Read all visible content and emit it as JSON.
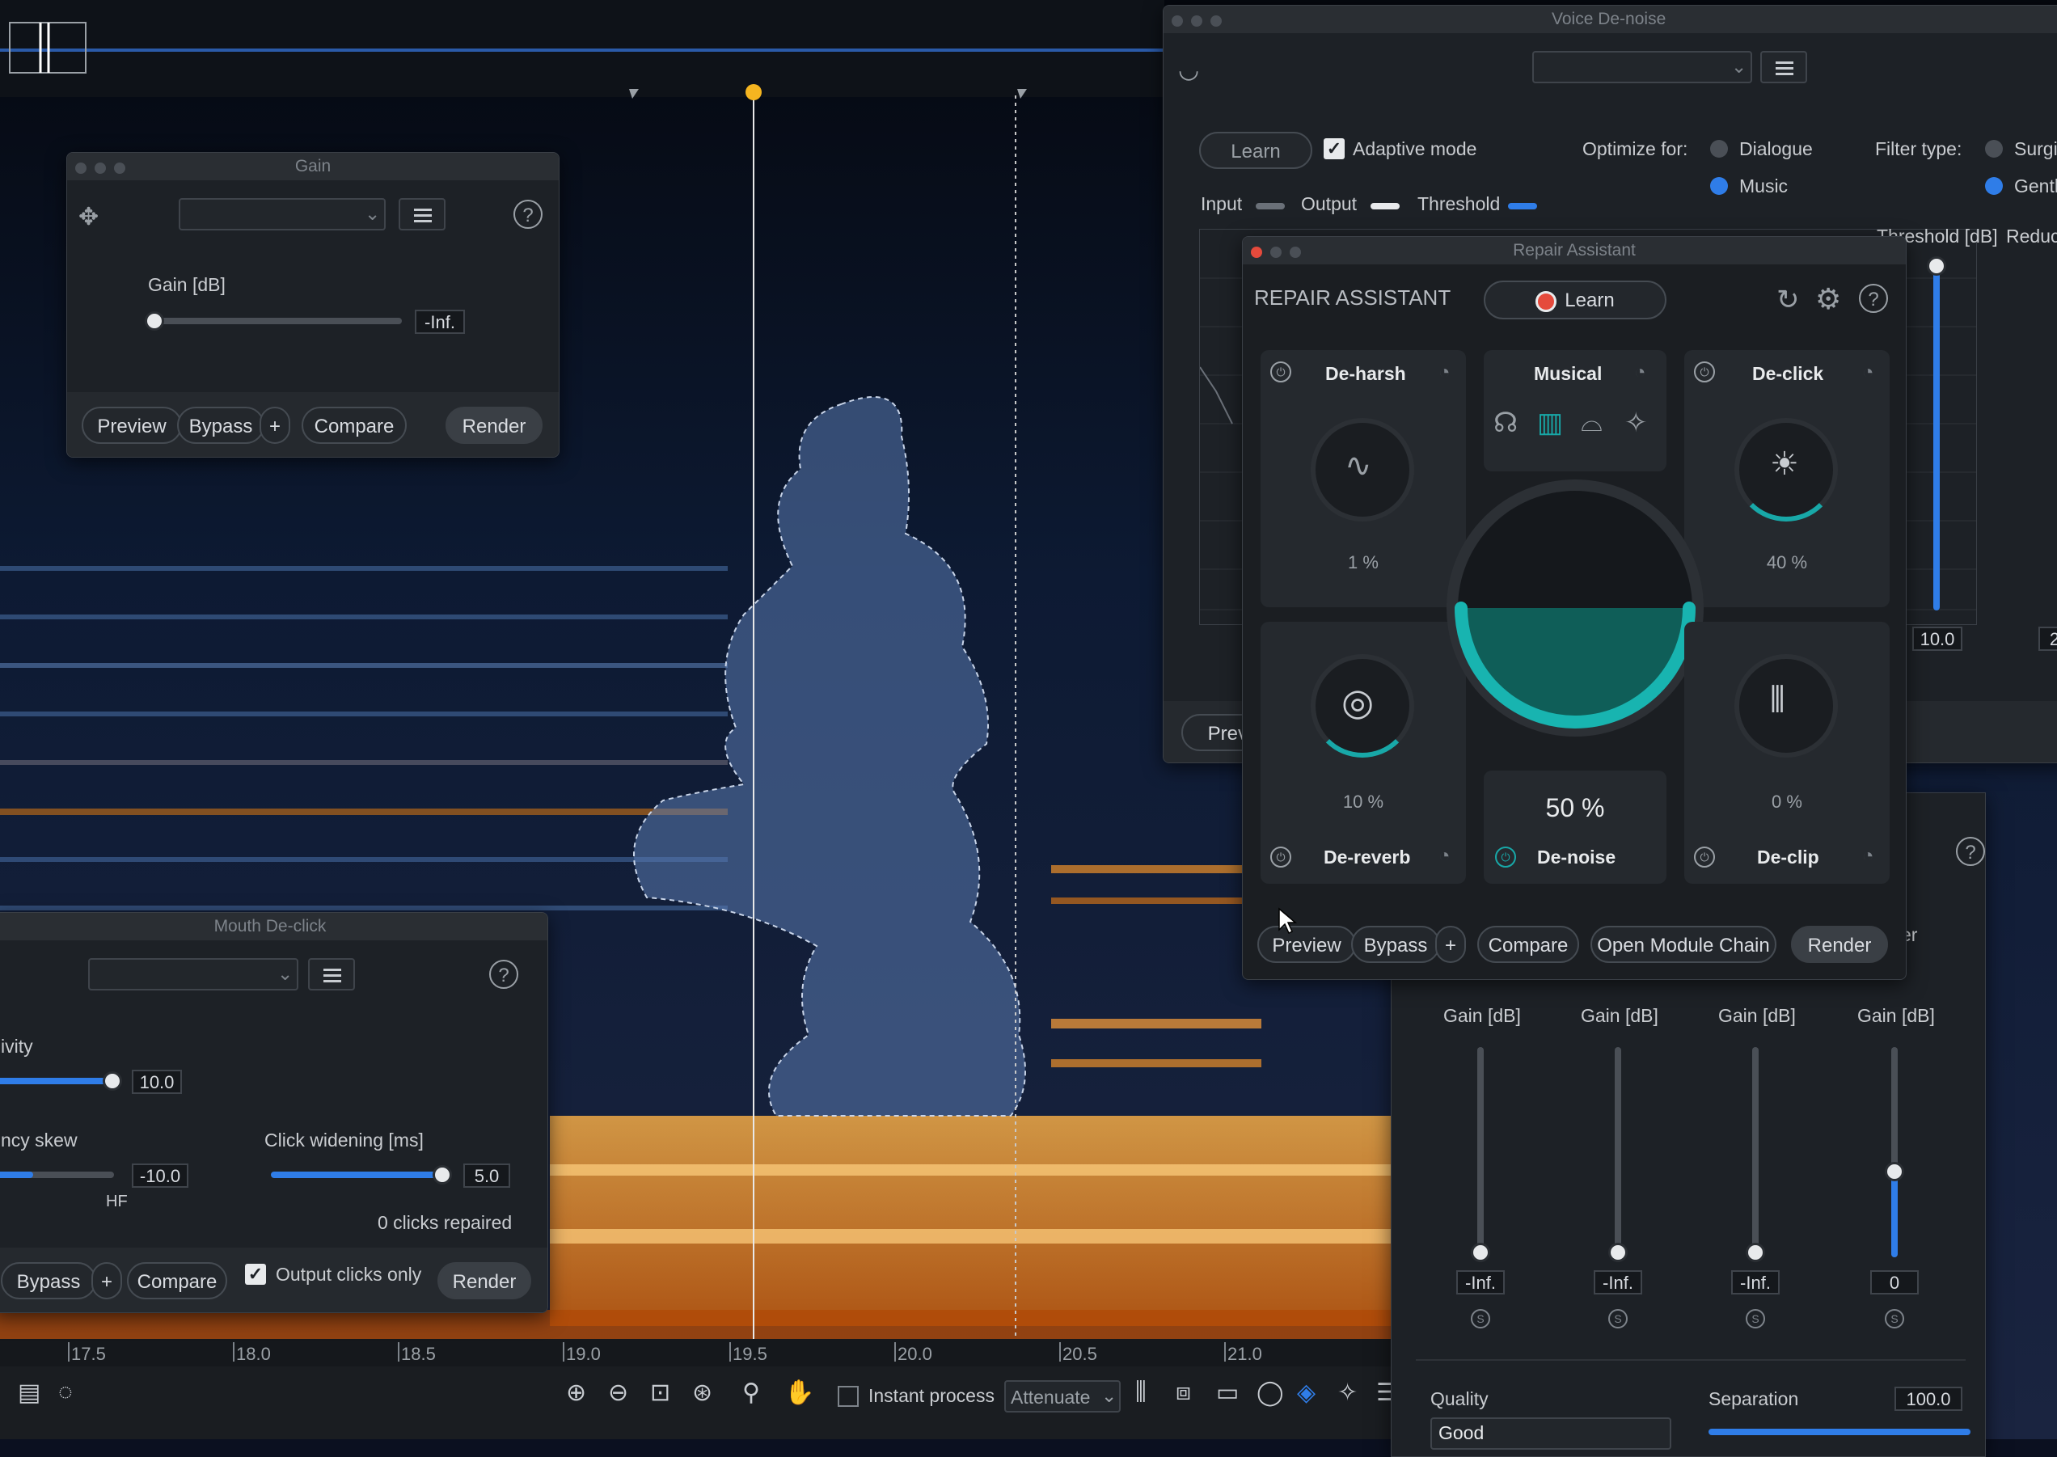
{
  "timeline": {
    "ticks": [
      "17.5",
      "18.0",
      "18.5",
      "19.0",
      "19.5",
      "20.0",
      "20.5",
      "21.0"
    ]
  },
  "gain_window": {
    "title": "Gain",
    "param_label": "Gain [dB]",
    "value": "-Inf.",
    "buttons": {
      "preview": "Preview",
      "bypass": "Bypass",
      "plus": "+",
      "compare": "Compare",
      "render": "Render"
    }
  },
  "mouth_declick": {
    "title": "Mouth De-click",
    "sensitivity_label": "ivity",
    "sensitivity_value": "10.0",
    "freq_skew_label": "ncy skew",
    "freq_skew_value": "-10.0",
    "hf_label": "HF",
    "click_widening_label": "Click widening [ms]",
    "click_widening_value": "5.0",
    "clicks_repaired": "0 clicks repaired",
    "output_clicks_only": "Output clicks only",
    "buttons": {
      "bypass": "Bypass",
      "plus": "+",
      "compare": "Compare",
      "render": "Render"
    }
  },
  "voice_denoise": {
    "title": "Voice De-noise",
    "learn": "Learn",
    "adaptive_mode": "Adaptive mode",
    "optimize_for": "Optimize for:",
    "opt_dialogue": "Dialogue",
    "opt_music": "Music",
    "filter_type": "Filter type:",
    "filter_surgical": "Surgi",
    "filter_gentle": "Gentl",
    "input": "Input",
    "output": "Output",
    "threshold": "Threshold",
    "threshold_db": "Threshold [dB]",
    "reduction": "Reduc",
    "threshold_value": "10.0",
    "right_value": "2",
    "preview_partial": "Previ"
  },
  "repair_assistant": {
    "title": "Repair Assistant",
    "heading": "REPAIR ASSISTANT",
    "learn": "Learn",
    "modules": {
      "deharsh": {
        "name": "De-harsh",
        "pct": "1 %"
      },
      "musical": {
        "name": "Musical"
      },
      "declick": {
        "name": "De-click",
        "pct": "40 %"
      },
      "dereverb": {
        "name": "De-reverb",
        "pct": "10 %"
      },
      "denoise": {
        "name": "De-noise",
        "pct": "50 %"
      },
      "declip": {
        "name": "De-clip",
        "pct": "0 %"
      }
    },
    "buttons": {
      "preview": "Preview",
      "bypass": "Bypass",
      "plus": "+",
      "compare": "Compare",
      "open_chain": "Open Module Chain",
      "render": "Render"
    }
  },
  "eq_panel": {
    "gain_label": "Gain [dB]",
    "bands": [
      "-Inf.",
      "-Inf.",
      "-Inf.",
      "0"
    ],
    "band_levels": [
      0,
      0,
      0,
      1
    ],
    "er_partial": "er",
    "quality_label": "Quality",
    "quality_value": "Good",
    "separation_label": "Separation",
    "separation_value": "100.0"
  },
  "toolbar": {
    "instant_process": "Instant process",
    "attenuate": "Attenuate"
  },
  "colors": {
    "accent": "#2f7de8",
    "teal": "#18a8a8",
    "spectro_hot": "#f08a1c"
  }
}
